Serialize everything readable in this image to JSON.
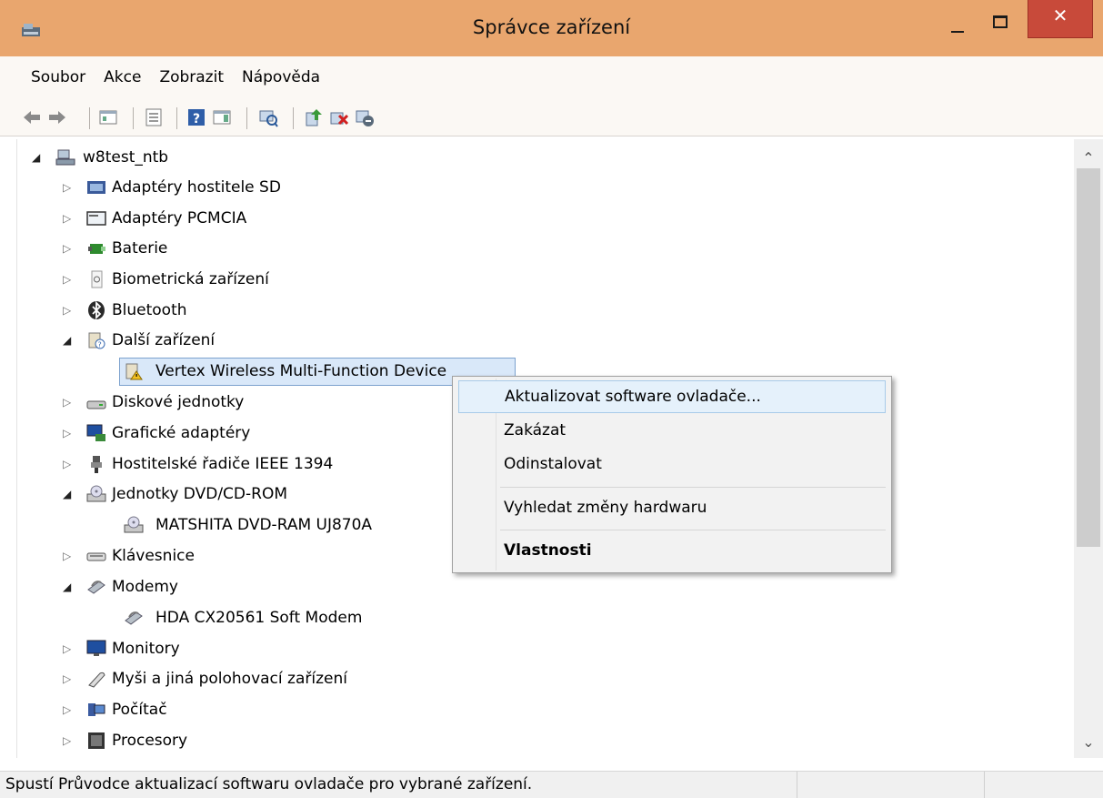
{
  "window": {
    "title": "Správce zařízení",
    "close_glyph": "✕"
  },
  "menu": [
    "Soubor",
    "Akce",
    "Zobrazit",
    "Nápověda"
  ],
  "toolbar_icons": [
    "back-arrow-icon",
    "forward-arrow-icon",
    "console-tree-icon",
    "properties-icon",
    "help-icon",
    "action-pane-icon",
    "scan-hardware-icon",
    "update-driver-icon",
    "uninstall-device-icon",
    "disable-device-icon"
  ],
  "tree": {
    "root": "w8test_ntb",
    "items": [
      {
        "label": "Adaptéry hostitele SD",
        "icon": "sd-host-adapter-icon",
        "expanded": false
      },
      {
        "label": "Adaptéry PCMCIA",
        "icon": "pcmcia-adapter-icon",
        "expanded": false
      },
      {
        "label": "Baterie",
        "icon": "battery-icon",
        "expanded": false
      },
      {
        "label": "Biometrická zařízení",
        "icon": "biometric-icon",
        "expanded": false
      },
      {
        "label": "Bluetooth",
        "icon": "bluetooth-icon",
        "expanded": false
      },
      {
        "label": "Další zařízení",
        "icon": "other-devices-icon",
        "expanded": true
      },
      {
        "label": "Vertex Wireless Multi-Function Device",
        "icon": "unknown-device-warning-icon",
        "child": true,
        "selected": true
      },
      {
        "label": "Diskové jednotky",
        "icon": "disk-drive-icon",
        "expanded": false
      },
      {
        "label": "Grafické adaptéry",
        "icon": "display-adapter-icon",
        "expanded": false
      },
      {
        "label": "Hostitelské řadiče IEEE 1394",
        "icon": "ieee1394-icon",
        "expanded": false
      },
      {
        "label": "Jednotky DVD/CD-ROM",
        "icon": "dvd-drive-icon",
        "expanded": true
      },
      {
        "label": "MATSHITA DVD-RAM UJ870A",
        "icon": "dvd-drive-icon",
        "child": true
      },
      {
        "label": "Klávesnice",
        "icon": "keyboard-icon",
        "expanded": false
      },
      {
        "label": "Modemy",
        "icon": "modem-icon",
        "expanded": true
      },
      {
        "label": "HDA CX20561 Soft Modem",
        "icon": "modem-icon",
        "child": true
      },
      {
        "label": "Monitory",
        "icon": "monitor-icon",
        "expanded": false
      },
      {
        "label": "Myši a jiná polohovací zařízení",
        "icon": "mouse-icon",
        "expanded": false
      },
      {
        "label": "Počítač",
        "icon": "computer-icon",
        "expanded": false
      },
      {
        "label": "Procesory",
        "icon": "processor-icon",
        "expanded": false
      }
    ]
  },
  "context_menu": {
    "items": [
      {
        "label": "Aktualizovat software ovladače...",
        "hover": true
      },
      {
        "label": "Zakázat"
      },
      {
        "label": "Odinstalovat"
      },
      {
        "label": "Vyhledat změny hardwaru"
      },
      {
        "label": "Vlastnosti",
        "bold": true
      }
    ]
  },
  "status": {
    "text": "Spustí Průvodce aktualizací softwaru ovladače pro vybrané zařízení."
  },
  "colors": {
    "titlebar": "#e9a66e",
    "close_button": "#c84a3a",
    "selection": "#d9e8f9",
    "menu_hover": "#e5f1fb"
  }
}
